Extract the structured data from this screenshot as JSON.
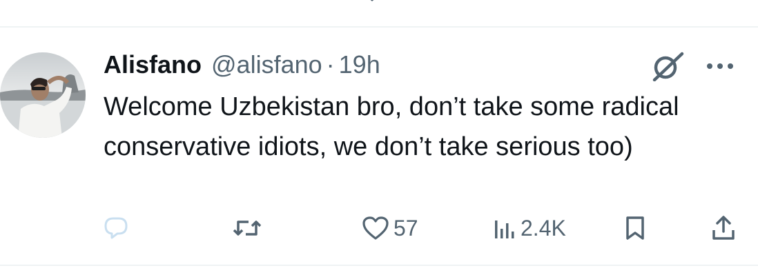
{
  "tweet": {
    "author_name": "Alisfano",
    "handle": "@alisfano",
    "separator": "·",
    "time": "19h",
    "text": "Welcome Uzbekistan bro, don’t take some radical conservative idiots, we don’t take serious too)"
  },
  "actions": {
    "reply_count": "",
    "retweet_count": "",
    "like_count": "57",
    "views_count": "2.4K"
  },
  "icons": [
    "reply-icon",
    "retweet-icon",
    "like-icon",
    "views-icon",
    "bookmark-icon",
    "share-icon",
    "grok-icon",
    "more-icon"
  ],
  "colors": {
    "text": "#0f1419",
    "secondary": "#536471",
    "divider": "#eff3f4"
  }
}
